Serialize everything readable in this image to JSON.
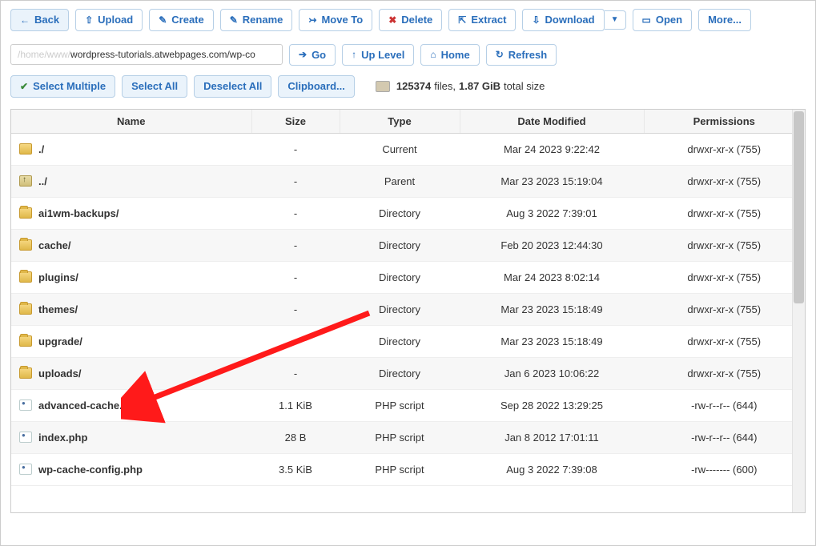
{
  "toolbar": {
    "back": "Back",
    "upload": "Upload",
    "create": "Create",
    "rename": "Rename",
    "moveTo": "Move To",
    "delete": "Delete",
    "extract": "Extract",
    "download": "Download",
    "open": "Open",
    "more": "More..."
  },
  "path": {
    "prefix": "/home/www/",
    "main": "wordpress-tutorials.atwebpages.com/wp-co"
  },
  "nav": {
    "go": "Go",
    "upLevel": "Up Level",
    "home": "Home",
    "refresh": "Refresh"
  },
  "select": {
    "selectMultiple": "Select Multiple",
    "selectAll": "Select All",
    "deselectAll": "Deselect All",
    "clipboard": "Clipboard..."
  },
  "status": {
    "fileCount": "125374",
    "filesLabel": "files,",
    "size": "1.87 GiB",
    "totalSizeLabel": "total size"
  },
  "columns": {
    "name": "Name",
    "size": "Size",
    "type": "Type",
    "dateModified": "Date Modified",
    "permissions": "Permissions"
  },
  "rows": [
    {
      "icon": "self",
      "name": "./",
      "size": "-",
      "type": "Current",
      "date": "Mar 24 2023 9:22:42",
      "perm": "drwxr-xr-x (755)"
    },
    {
      "icon": "up",
      "name": "../",
      "size": "-",
      "type": "Parent",
      "date": "Mar 23 2023 15:19:04",
      "perm": "drwxr-xr-x (755)"
    },
    {
      "icon": "folder",
      "name": "ai1wm-backups/",
      "size": "-",
      "type": "Directory",
      "date": "Aug 3 2022 7:39:01",
      "perm": "drwxr-xr-x (755)"
    },
    {
      "icon": "folder",
      "name": "cache/",
      "size": "-",
      "type": "Directory",
      "date": "Feb 20 2023 12:44:30",
      "perm": "drwxr-xr-x (755)"
    },
    {
      "icon": "folder",
      "name": "plugins/",
      "size": "-",
      "type": "Directory",
      "date": "Mar 24 2023 8:02:14",
      "perm": "drwxr-xr-x (755)"
    },
    {
      "icon": "folder",
      "name": "themes/",
      "size": "-",
      "type": "Directory",
      "date": "Mar 23 2023 15:18:49",
      "perm": "drwxr-xr-x (755)"
    },
    {
      "icon": "folder",
      "name": "upgrade/",
      "size": "-",
      "type": "Directory",
      "date": "Mar 23 2023 15:18:49",
      "perm": "drwxr-xr-x (755)"
    },
    {
      "icon": "folder",
      "name": "uploads/",
      "size": "-",
      "type": "Directory",
      "date": "Jan 6 2023 10:06:22",
      "perm": "drwxr-xr-x (755)"
    },
    {
      "icon": "php",
      "name": "advanced-cache.php",
      "size": "1.1 KiB",
      "type": "PHP script",
      "date": "Sep 28 2022 13:29:25",
      "perm": "-rw-r--r-- (644)"
    },
    {
      "icon": "php",
      "name": "index.php",
      "size": "28 B",
      "type": "PHP script",
      "date": "Jan 8 2012 17:01:11",
      "perm": "-rw-r--r-- (644)"
    },
    {
      "icon": "php",
      "name": "wp-cache-config.php",
      "size": "3.5 KiB",
      "type": "PHP script",
      "date": "Aug 3 2022 7:39:08",
      "perm": "-rw------- (600)"
    }
  ]
}
